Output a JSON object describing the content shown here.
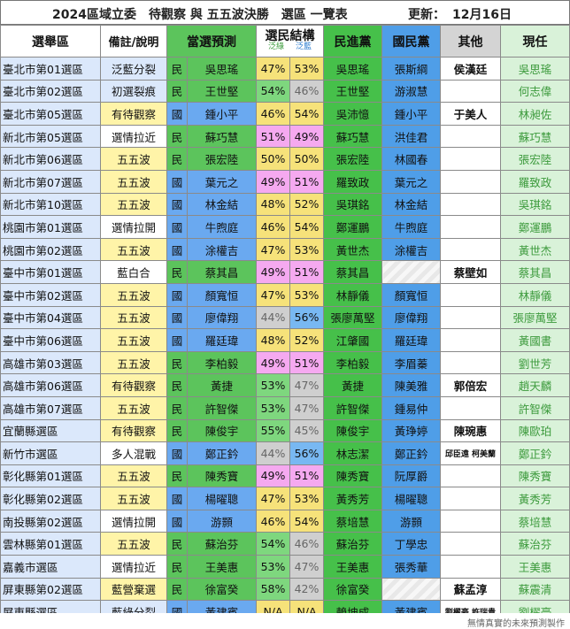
{
  "title": {
    "main": "2024區域立委　待觀察 與 五五波決勝　選區 一覽表",
    "updated_label": "更新：",
    "updated_date": "12月16日"
  },
  "headers": {
    "district": "選舉區",
    "note": "備註/說明",
    "predicted": "當選預測",
    "structure": "選民結構",
    "green": "泛綠",
    "blue": "泛藍",
    "dpp": "民進黨",
    "kmt": "國民黨",
    "other": "其他",
    "incumbent": "現任"
  },
  "rows": [
    {
      "district": "臺北市第01選區",
      "note": "泛藍分裂",
      "note_style": "note-blue",
      "party": "民",
      "predicted": "吳思瑤",
      "green": "47%",
      "blue": "53%",
      "dpp": "吳思瑤",
      "kmt": "張斯綱",
      "other": "侯漢廷",
      "incumbent": "吳思瑤"
    },
    {
      "district": "臺北市第02選區",
      "note": "初選裂痕",
      "note_style": "note-blue",
      "party": "民",
      "predicted": "王世堅",
      "green": "54%",
      "blue": "46%",
      "dpp": "王世堅",
      "kmt": "游淑慧",
      "other": "",
      "incumbent": "何志偉"
    },
    {
      "district": "臺北市第05選區",
      "note": "有待觀察",
      "note_style": "note-yellow",
      "party": "國",
      "predicted": "鍾小平",
      "green": "46%",
      "blue": "54%",
      "dpp": "吳沛憶",
      "kmt": "鍾小平",
      "other": "于美人",
      "incumbent": "林昶佐"
    },
    {
      "district": "新北市第05選區",
      "note": "選情拉近",
      "note_style": "note-white",
      "party": "民",
      "predicted": "蘇巧慧",
      "green": "51%",
      "blue": "49%",
      "dpp": "蘇巧慧",
      "kmt": "洪佳君",
      "other": "",
      "incumbent": "蘇巧慧"
    },
    {
      "district": "新北市第06選區",
      "note": "五五波",
      "note_style": "note-yellow",
      "party": "民",
      "predicted": "張宏陸",
      "green": "50%",
      "blue": "50%",
      "dpp": "張宏陸",
      "kmt": "林國春",
      "other": "",
      "incumbent": "張宏陸"
    },
    {
      "district": "新北市第07選區",
      "note": "五五波",
      "note_style": "note-yellow",
      "party": "國",
      "predicted": "葉元之",
      "green": "49%",
      "blue": "51%",
      "dpp": "羅致政",
      "kmt": "葉元之",
      "other": "",
      "incumbent": "羅致政"
    },
    {
      "district": "新北市第10選區",
      "note": "五五波",
      "note_style": "note-yellow",
      "party": "國",
      "predicted": "林金結",
      "green": "48%",
      "blue": "52%",
      "dpp": "吳琪銘",
      "kmt": "林金結",
      "other": "",
      "incumbent": "吳琪銘"
    },
    {
      "district": "桃園市第01選區",
      "note": "選情拉開",
      "note_style": "note-white",
      "party": "國",
      "predicted": "牛煦庭",
      "green": "46%",
      "blue": "54%",
      "dpp": "鄭運鵬",
      "kmt": "牛煦庭",
      "other": "",
      "incumbent": "鄭運鵬"
    },
    {
      "district": "桃園市第02選區",
      "note": "五五波",
      "note_style": "note-yellow",
      "party": "國",
      "predicted": "涂權吉",
      "green": "47%",
      "blue": "53%",
      "dpp": "黃世杰",
      "kmt": "涂權吉",
      "other": "",
      "incumbent": "黃世杰"
    },
    {
      "district": "臺中市第01選區",
      "note": "藍白合",
      "note_style": "note-white",
      "party": "民",
      "predicted": "蔡其昌",
      "green": "49%",
      "blue": "51%",
      "dpp": "蔡其昌",
      "kmt": "",
      "other": "蔡壁如",
      "incumbent": "蔡其昌"
    },
    {
      "district": "臺中市第02選區",
      "note": "五五波",
      "note_style": "note-yellow",
      "party": "國",
      "predicted": "顏寬恒",
      "green": "47%",
      "blue": "53%",
      "dpp": "林靜儀",
      "kmt": "顏寬恒",
      "other": "",
      "incumbent": "林靜儀"
    },
    {
      "district": "臺中市第04選區",
      "note": "五五波",
      "note_style": "note-yellow",
      "party": "國",
      "predicted": "廖偉翔",
      "green": "44%",
      "blue": "56%",
      "dpp": "張廖萬堅",
      "kmt": "廖偉翔",
      "other": "",
      "incumbent": "張廖萬堅"
    },
    {
      "district": "臺中市第06選區",
      "note": "五五波",
      "note_style": "note-yellow",
      "party": "國",
      "predicted": "羅廷瑋",
      "green": "48%",
      "blue": "52%",
      "dpp": "江肇國",
      "kmt": "羅廷瑋",
      "other": "",
      "incumbent": "黃國書"
    },
    {
      "district": "高雄市第03選區",
      "note": "五五波",
      "note_style": "note-yellow",
      "party": "民",
      "predicted": "李柏毅",
      "green": "49%",
      "blue": "51%",
      "dpp": "李柏毅",
      "kmt": "李眉蓁",
      "other": "",
      "incumbent": "劉世芳"
    },
    {
      "district": "高雄市第06選區",
      "note": "有待觀察",
      "note_style": "note-yellow",
      "party": "民",
      "predicted": "黃捷",
      "green": "53%",
      "blue": "47%",
      "dpp": "黃捷",
      "kmt": "陳美雅",
      "other": "郭倍宏",
      "incumbent": "趙天麟"
    },
    {
      "district": "高雄市第07選區",
      "note": "五五波",
      "note_style": "note-yellow",
      "party": "民",
      "predicted": "許智傑",
      "green": "53%",
      "blue": "47%",
      "dpp": "許智傑",
      "kmt": "鍾易仲",
      "other": "",
      "incumbent": "許智傑"
    },
    {
      "district": "宜蘭縣選區",
      "note": "有待觀察",
      "note_style": "note-yellow",
      "party": "民",
      "predicted": "陳俊宇",
      "green": "55%",
      "blue": "45%",
      "dpp": "陳俊宇",
      "kmt": "黃琤婷",
      "other": "陳琬惠",
      "incumbent": "陳歐珀"
    },
    {
      "district": "新竹市選區",
      "note": "多人混戰",
      "note_style": "note-white",
      "party": "國",
      "predicted": "鄭正鈐",
      "green": "44%",
      "blue": "56%",
      "dpp": "林志潔",
      "kmt": "鄭正鈐",
      "other": "邱臣遠 柯美蘭",
      "incumbent": "鄭正鈐"
    },
    {
      "district": "彰化縣第01選區",
      "note": "五五波",
      "note_style": "note-yellow",
      "party": "民",
      "predicted": "陳秀寶",
      "green": "49%",
      "blue": "51%",
      "dpp": "陳秀寶",
      "kmt": "阮厚爵",
      "other": "",
      "incumbent": "陳秀寶"
    },
    {
      "district": "彰化縣第02選區",
      "note": "五五波",
      "note_style": "note-yellow",
      "party": "國",
      "predicted": "楊曜聰",
      "green": "47%",
      "blue": "53%",
      "dpp": "黃秀芳",
      "kmt": "楊曜聰",
      "other": "",
      "incumbent": "黃秀芳"
    },
    {
      "district": "南投縣第02選區",
      "note": "選情拉開",
      "note_style": "note-white",
      "party": "國",
      "predicted": "游顥",
      "green": "46%",
      "blue": "54%",
      "dpp": "蔡培慧",
      "kmt": "游顥",
      "other": "",
      "incumbent": "蔡培慧"
    },
    {
      "district": "雲林縣第01選區",
      "note": "五五波",
      "note_style": "note-yellow",
      "party": "民",
      "predicted": "蘇治芬",
      "green": "54%",
      "blue": "46%",
      "dpp": "蘇治芬",
      "kmt": "丁學忠",
      "other": "",
      "incumbent": "蘇治芬"
    },
    {
      "district": "嘉義市選區",
      "note": "選情拉近",
      "note_style": "note-white",
      "party": "民",
      "predicted": "王美惠",
      "green": "53%",
      "blue": "47%",
      "dpp": "王美惠",
      "kmt": "張秀華",
      "other": "",
      "incumbent": "王美惠"
    },
    {
      "district": "屏東縣第02選區",
      "note": "藍營棄選",
      "note_style": "note-yellow",
      "party": "民",
      "predicted": "徐富癸",
      "green": "58%",
      "blue": "42%",
      "dpp": "徐富癸",
      "kmt": "",
      "other": "蘇孟淳",
      "incumbent": "蘇震清"
    },
    {
      "district": "屏東縣選區",
      "note": "藍綠分裂",
      "note_style": "note-blue",
      "party": "國",
      "predicted": "黃建賓",
      "green": "N/A",
      "blue": "N/A",
      "dpp": "賴坤成",
      "kmt": "黃建賓",
      "other": "劉櫂豪 許瑞貴",
      "incumbent": "劉櫂豪"
    }
  ],
  "footer": "無情真實的未來預測製作",
  "colors": {
    "dpp": "#46c04a",
    "kmt": "#4f9ee8",
    "incumbent_text": "#3c9a3c",
    "note_yellow": "#fff4a8",
    "note_blue": "#dbe8fb"
  }
}
